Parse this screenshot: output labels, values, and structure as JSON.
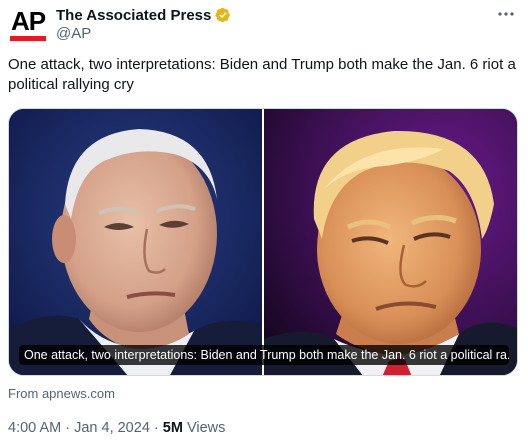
{
  "account": {
    "display_name": "The Associated Press",
    "handle": "@AP",
    "avatar_text": "AP",
    "verified_color": "#e2b719"
  },
  "tweet": {
    "text": "One attack, two interpretations: Biden and Trump both make the Jan. 6 riot a political rallying cry"
  },
  "media": {
    "caption": "One attack, two interpretations: Biden and Trump both make the Jan. 6 riot a political ra...",
    "left_photo": "photo-biden",
    "right_photo": "photo-trump"
  },
  "link_source": "From apnews.com",
  "meta": {
    "time": "4:00 AM",
    "separator1": " · ",
    "date": "Jan 4, 2024",
    "separator2": " · ",
    "views_count": "5M",
    "views_label": " Views"
  },
  "icons": {
    "more": "more-icon",
    "verified": "verified-badge-icon"
  },
  "colors": {
    "text_primary": "#0f1419",
    "text_secondary": "#536471",
    "ap_red": "#e31b23"
  }
}
